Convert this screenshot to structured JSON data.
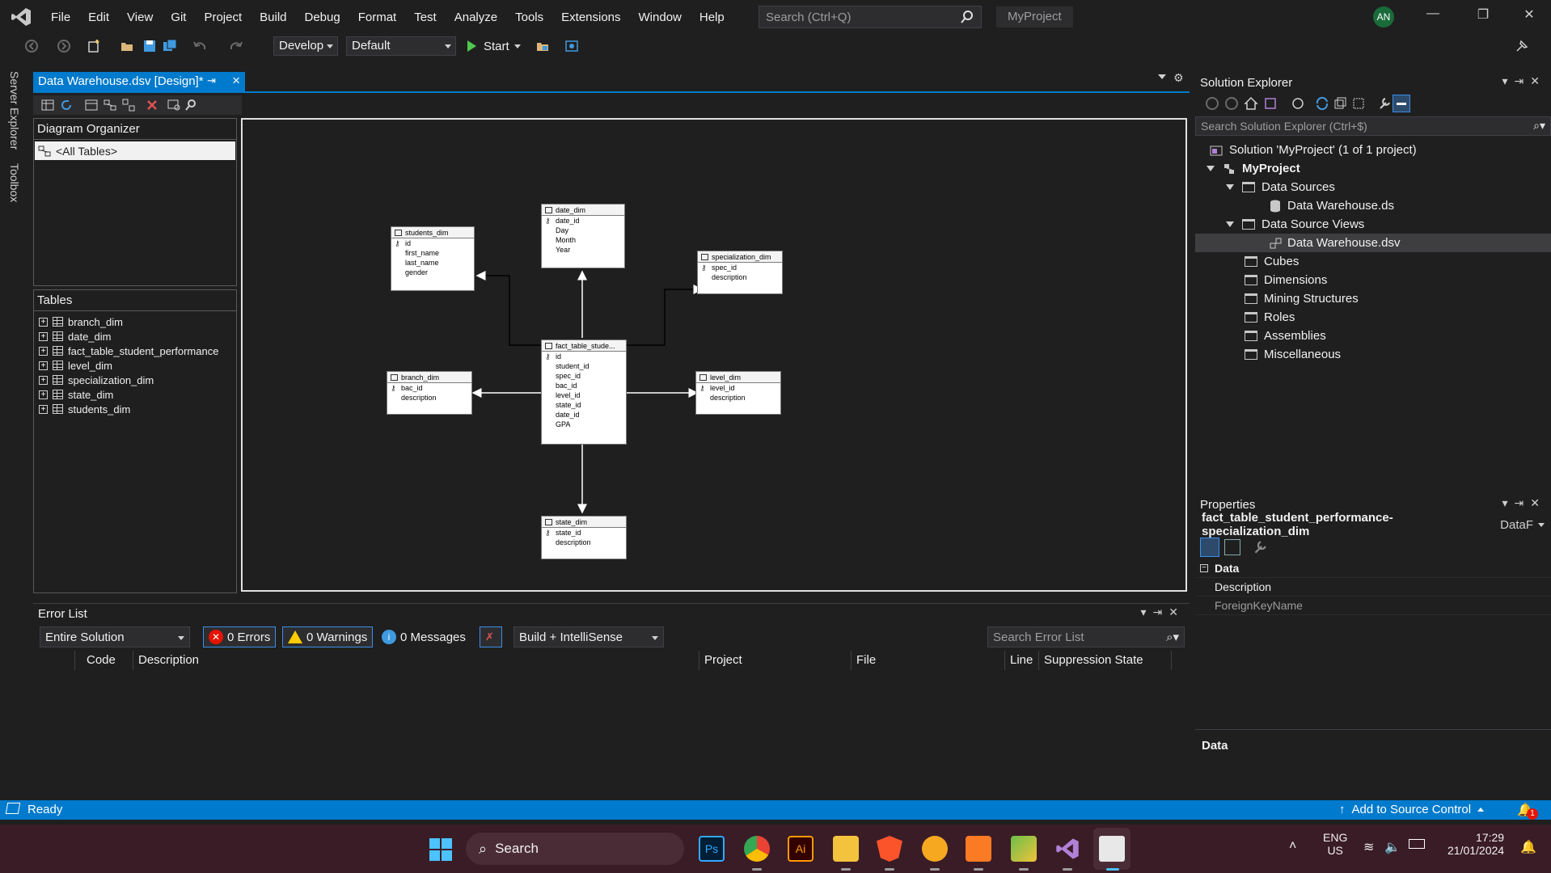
{
  "menu": {
    "items": [
      "File",
      "Edit",
      "View",
      "Git",
      "Project",
      "Build",
      "Debug",
      "Format",
      "Test",
      "Analyze",
      "Tools",
      "Extensions",
      "Window",
      "Help"
    ],
    "search_placeholder": "Search (Ctrl+Q)",
    "project_name": "MyProject",
    "user_initials": "AN"
  },
  "toolbar": {
    "config": "Develop",
    "platform": "Default",
    "start_label": "Start"
  },
  "left_tabs": [
    "Server Explorer",
    "Toolbox"
  ],
  "document_tab": {
    "title": "Data Warehouse.dsv [Design]*"
  },
  "diagram_organizer": {
    "title": "Diagram Organizer",
    "selected": "<All Tables>"
  },
  "tables_panel": {
    "title": "Tables",
    "items": [
      "branch_dim",
      "date_dim",
      "fact_table_student_performance",
      "level_dim",
      "specialization_dim",
      "state_dim",
      "students_dim"
    ]
  },
  "diagram": {
    "tables": [
      {
        "name": "students_dim",
        "columns": [
          "id",
          "first_name",
          "last_name",
          "gender"
        ]
      },
      {
        "name": "date_dim",
        "columns": [
          "date_id",
          "Day",
          "Month",
          "Year"
        ]
      },
      {
        "name": "specialization_dim",
        "columns": [
          "spec_id",
          "description"
        ]
      },
      {
        "name": "fact_table_stude...",
        "columns": [
          "id",
          "student_id",
          "spec_id",
          "bac_id",
          "level_id",
          "state_id",
          "date_id",
          "GPA"
        ]
      },
      {
        "name": "branch_dim",
        "columns": [
          "bac_id",
          "description"
        ]
      },
      {
        "name": "level_dim",
        "columns": [
          "level_id",
          "description"
        ]
      },
      {
        "name": "state_dim",
        "columns": [
          "state_id",
          "description"
        ]
      }
    ]
  },
  "solution_explorer": {
    "title": "Solution Explorer",
    "search_placeholder": "Search Solution Explorer (Ctrl+$)",
    "solution": "Solution 'MyProject' (1 of 1 project)",
    "project": "MyProject",
    "nodes": {
      "data_sources": "Data Sources",
      "data_source_file": "Data Warehouse.ds",
      "data_source_views": "Data Source Views",
      "dsv_file": "Data Warehouse.dsv",
      "cubes": "Cubes",
      "dimensions": "Dimensions",
      "mining": "Mining Structures",
      "roles": "Roles",
      "assemblies": "Assemblies",
      "misc": "Miscellaneous"
    }
  },
  "properties": {
    "title": "Properties",
    "object_name": "fact_table_student_performance-specialization_dim",
    "object_type": "DataF",
    "category": "Data",
    "rows": [
      "Description",
      "ForeignKeyName"
    ],
    "footer_label": "Data"
  },
  "error_list": {
    "title": "Error List",
    "scope": "Entire Solution",
    "errors": "0 Errors",
    "warnings": "0 Warnings",
    "messages": "0 Messages",
    "source": "Build + IntelliSense",
    "search_placeholder": "Search Error List",
    "columns": [
      "Code",
      "Description",
      "Project",
      "File",
      "Line",
      "Suppression State"
    ]
  },
  "status_bar": {
    "status": "Ready",
    "source_control": "Add to Source Control",
    "notifications": "1"
  },
  "taskbar": {
    "search": "Search",
    "lang": "ENG",
    "region": "US",
    "time": "17:29",
    "date": "21/01/2024"
  },
  "colors": {
    "accent": "#007acc",
    "bg": "#1f1f1f",
    "taskbar": "#3a1c26"
  }
}
